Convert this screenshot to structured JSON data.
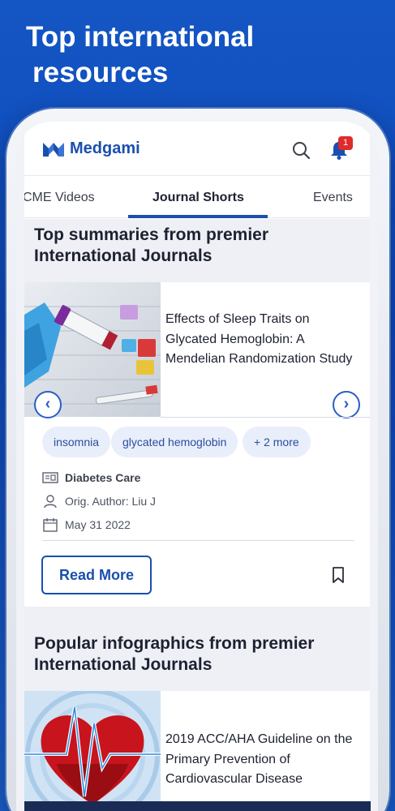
{
  "promo": {
    "headline_line1": "Top international",
    "headline_line2": "resources"
  },
  "app": {
    "brand": "Medgami",
    "notification_count": "1",
    "brand_color": "#1a4fae"
  },
  "tabs": [
    {
      "label": "CME Videos",
      "active": false
    },
    {
      "label": "Journal Shorts",
      "active": true
    },
    {
      "label": "Events",
      "active": false
    }
  ],
  "section1": {
    "title_line1": "Top summaries from premier",
    "title_line2": "International Journals"
  },
  "card": {
    "title": "Effects of Sleep Traits on Glycated Hemoglobin: A Mendelian Randomization Study",
    "tags": [
      "insomnia",
      "glycated hemoglobin",
      "+ 2 more"
    ],
    "journal": "Diabetes Care",
    "author": "Orig. Author: Liu J",
    "date": "May 31 2022",
    "read_more": "Read More",
    "prev_icon": "chevron-left-icon",
    "next_icon": "chevron-right-icon"
  },
  "section2": {
    "title_line1": "Popular infographics from premier",
    "title_line2": "International Journals"
  },
  "card2": {
    "title": "2019 ACC/AHA Guideline on the Primary Prevention of Cardiovascular Disease"
  }
}
